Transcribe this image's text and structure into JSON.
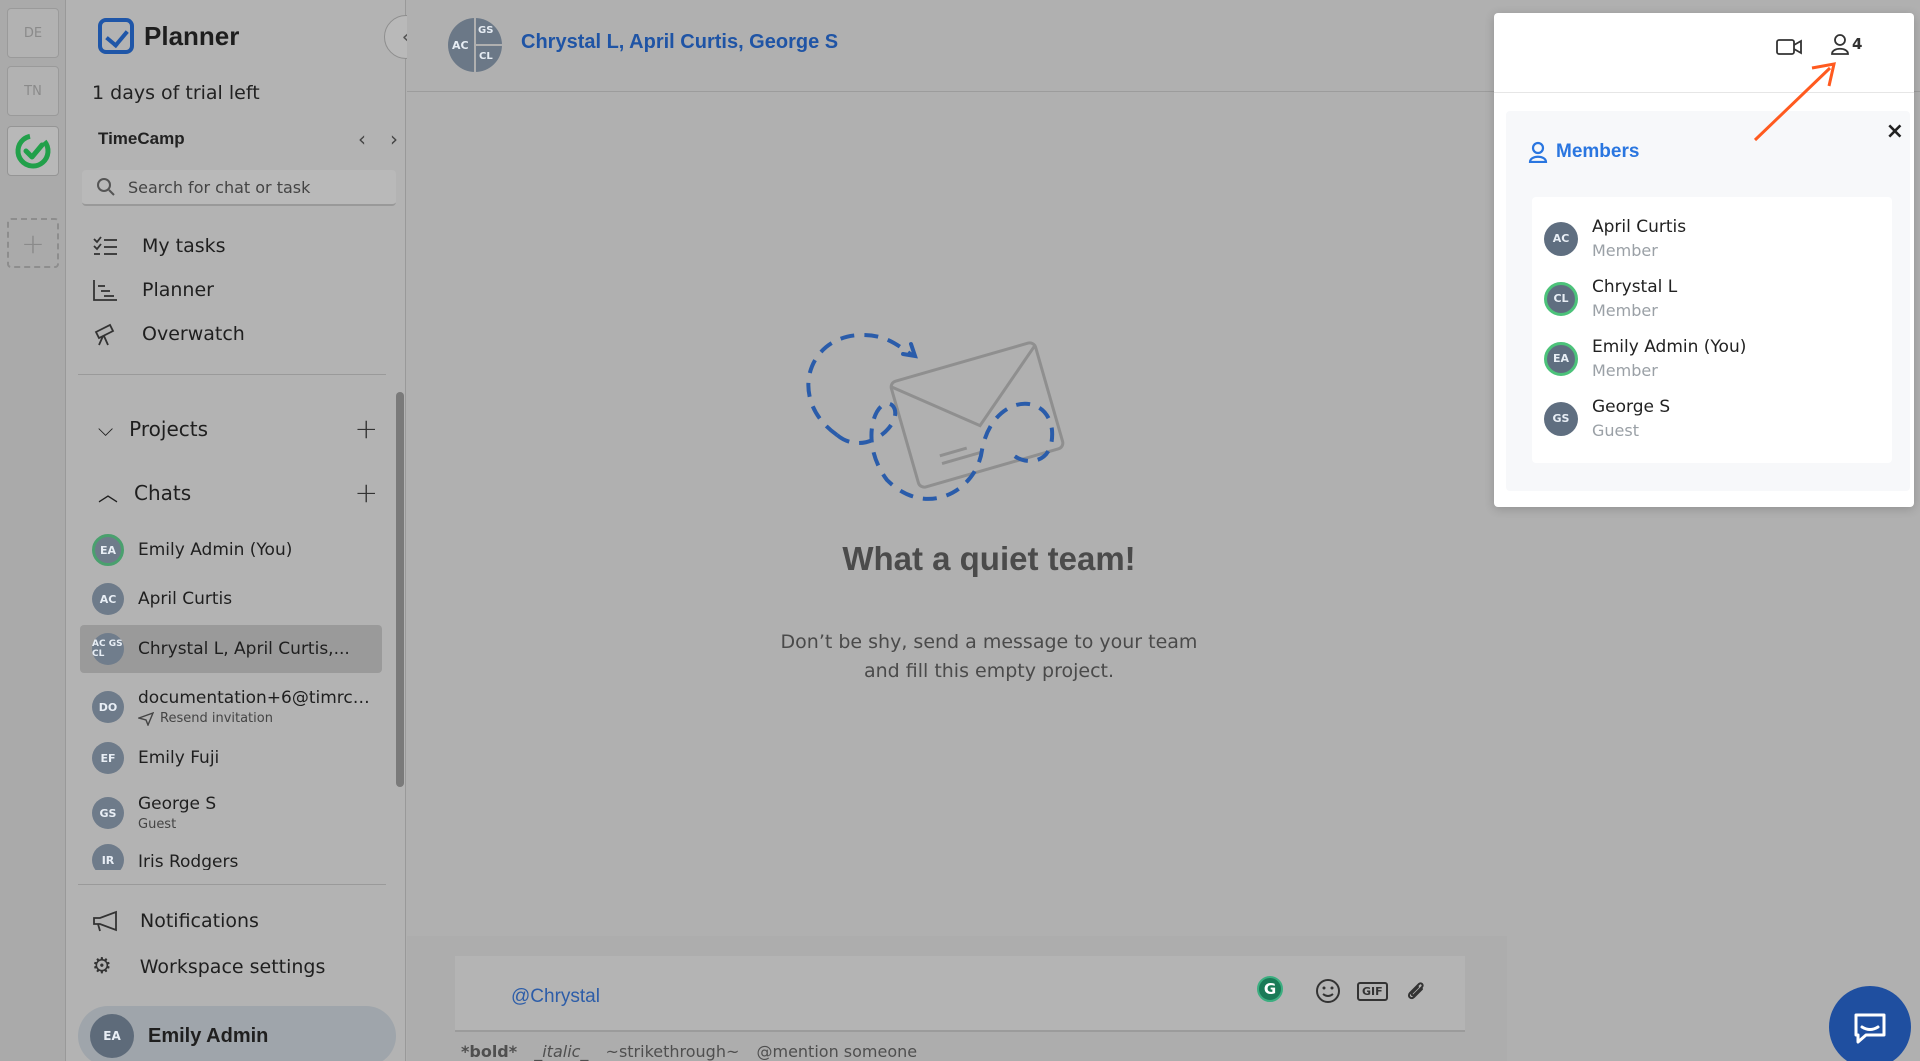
{
  "workspaces": [
    {
      "label": "DE"
    },
    {
      "label": "TN"
    },
    {
      "label": "",
      "icon": "timecamp-logo-icon"
    },
    {
      "label": "+",
      "icon": "plus-icon"
    }
  ],
  "sidebar": {
    "app_name": "Planner",
    "trial": "1 days of trial left",
    "workspace_name": "TimeCamp",
    "search_placeholder": "Search for chat or task",
    "nav": [
      {
        "label": "My tasks",
        "icon": "checklist-icon"
      },
      {
        "label": "Planner",
        "icon": "gantt-icon"
      },
      {
        "label": "Overwatch",
        "icon": "telescope-icon"
      }
    ],
    "projects_label": "Projects",
    "chats_label": "Chats",
    "chats": [
      {
        "initials": "EA",
        "name": "Emily Admin (You)",
        "sub": ""
      },
      {
        "initials": "AC",
        "name": "April Curtis",
        "sub": ""
      },
      {
        "initials": "AC GS CL",
        "name": "Chrystal L, April Curtis,...",
        "sub": ""
      },
      {
        "initials": "DO",
        "name": "documentation+6@timrca...",
        "sub": "Resend invitation"
      },
      {
        "initials": "EF",
        "name": "Emily Fuji",
        "sub": ""
      },
      {
        "initials": "GS",
        "name": "George S",
        "sub": "Guest"
      },
      {
        "initials": "IR",
        "name": "Iris Rodgers",
        "sub": ""
      }
    ],
    "notifications_label": "Notifications",
    "settings_label": "Workspace settings",
    "user": {
      "initials": "EA",
      "name": "Emily Admin"
    }
  },
  "main": {
    "chat_title": "Chrystal L, April Curtis, George S",
    "group_initials": {
      "a": "AC",
      "b": "GS",
      "c": "CL"
    },
    "empty_title": "What a quiet team!",
    "empty_line1": "Don’t be shy, send a message to your team",
    "empty_line2": "and fill this empty project.",
    "composer_value": "@Chrystal",
    "grammarly": "G",
    "gif": "GIF",
    "hints": {
      "bold": "*bold*",
      "italic": "_italic_",
      "strike": "~strikethrough~",
      "mention": "@mention someone"
    }
  },
  "popup": {
    "member_count": "4",
    "title": "Members",
    "close": "×",
    "members": [
      {
        "initials": "AC",
        "name": "April Curtis",
        "role": "Member"
      },
      {
        "initials": "CL",
        "name": "Chrystal L",
        "role": "Member"
      },
      {
        "initials": "EA",
        "name": "Emily Admin (You)",
        "role": "Member"
      },
      {
        "initials": "GS",
        "name": "George S",
        "role": "Guest"
      }
    ]
  },
  "colors": {
    "brand_blue": "#1f54a5",
    "members_blue": "#2a76e0",
    "arrow": "#ff5a1f"
  }
}
